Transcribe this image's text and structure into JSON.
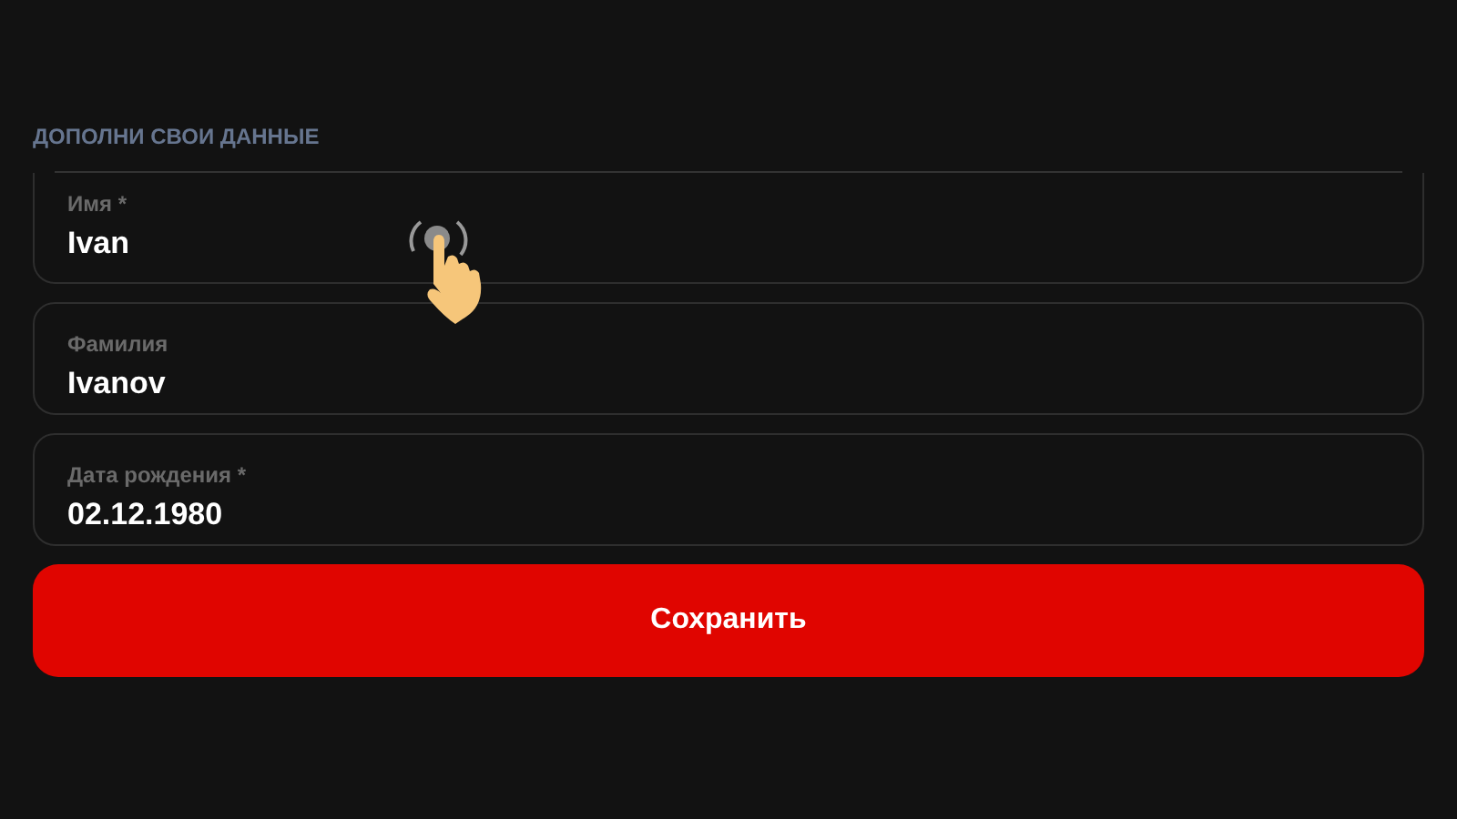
{
  "section_title": "ДОПОЛНИ СВОИ ДАННЫЕ",
  "fields": [
    {
      "label": "Имя *",
      "value": "Ivan"
    },
    {
      "label": "Фамилия",
      "value": "Ivanov"
    },
    {
      "label": "Дата рождения *",
      "value": "02.12.1980"
    }
  ],
  "submit_button": "Сохранить"
}
